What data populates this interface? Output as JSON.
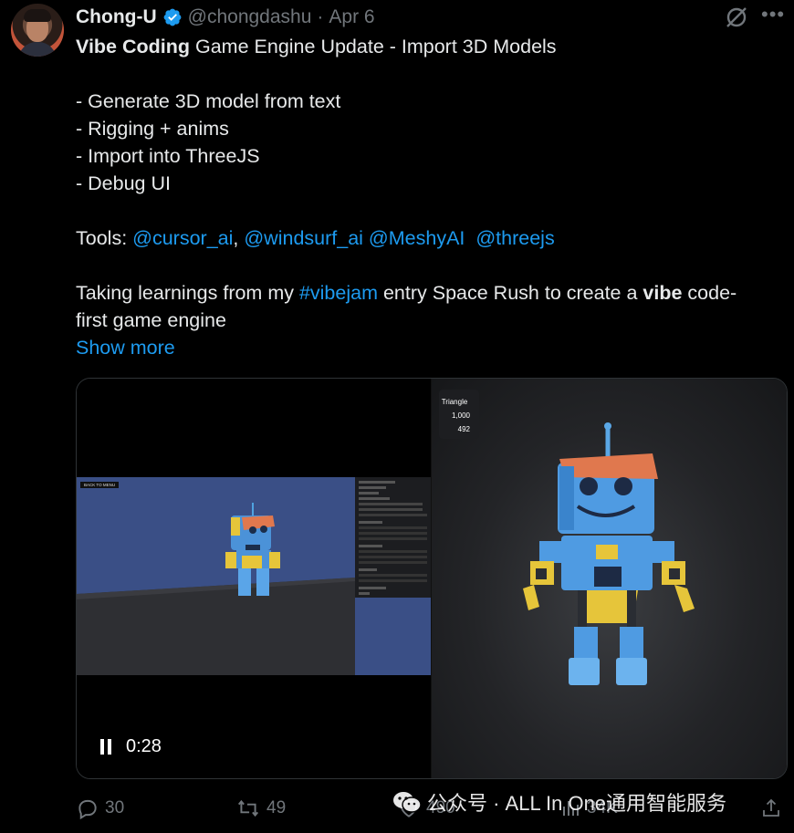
{
  "tweet": {
    "author_name": "Chong-U",
    "author_handle": "@chongdashu",
    "separator": "·",
    "date": "Apr 6",
    "title_bold": "Vibe Coding",
    "title_rest": " Game Engine Update - Import 3D Models",
    "bullets": [
      "- Generate 3D model from text",
      "- Rigging + anims",
      "- Import into ThreeJS",
      "- Debug UI"
    ],
    "tools_prefix": "Tools: ",
    "tools": [
      "@cursor_ai",
      "@windsurf_ai",
      "@MeshyAI",
      "@threejs"
    ],
    "tools_sep1": ", ",
    "tools_sep2": " ",
    "tools_sep3": "  ",
    "line_taking_1": "Taking learnings from my ",
    "hashtag": "#vibejam",
    "line_taking_2": " entry Space Rush to create a ",
    "line_bold_vibe": "vibe",
    "line_taking_3": " code-",
    "line_taking_4": "first game engine",
    "show_more": "Show more"
  },
  "media": {
    "back_to_menu": "BACK TO MENU",
    "stats_label": "Triangle",
    "stats_value_1": "1,000",
    "stats_value_2": "492",
    "timecode": "0:28"
  },
  "actions": {
    "replies": "30",
    "reposts": "49",
    "likes": "490",
    "views": "34K"
  },
  "watermark": {
    "text": "公众号 · ALL In One通用智能服务"
  },
  "colors": {
    "background": "#000000",
    "link": "#1d9bf0",
    "muted": "#71767b",
    "text": "#e7e9ea"
  }
}
